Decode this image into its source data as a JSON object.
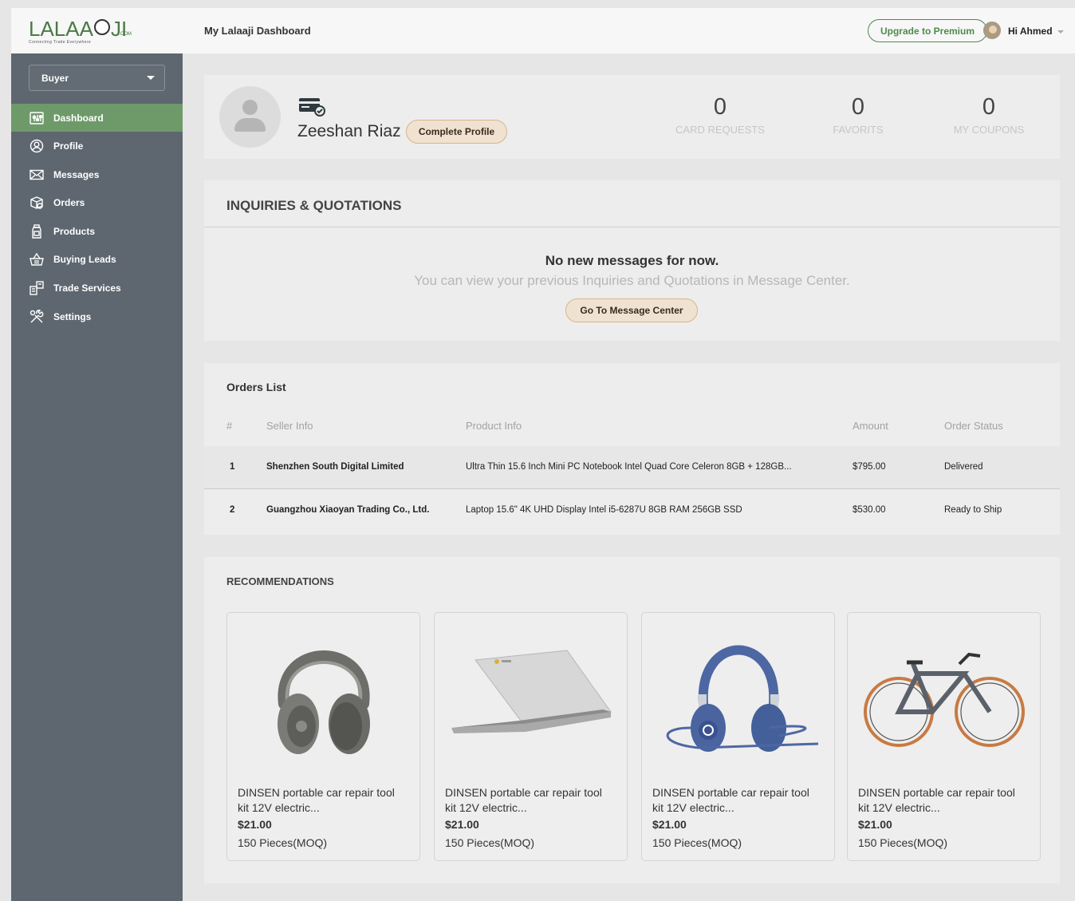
{
  "brand": {
    "logo_text": "LALAA",
    "logo_suffix": "JI",
    "logo_com": ".COM",
    "tagline": "Connecting Trade Everywhere"
  },
  "header": {
    "title": "My Lalaaji Dashboard",
    "upgrade_label": "Upgrade to Premium",
    "greeting": "Hi Ahmed"
  },
  "sidebar": {
    "role": "Buyer",
    "items": [
      {
        "label": "Dashboard",
        "icon": "dashboard-icon"
      },
      {
        "label": "Profile",
        "icon": "user-icon"
      },
      {
        "label": "Messages",
        "icon": "envelope-icon"
      },
      {
        "label": "Orders",
        "icon": "box-icon"
      },
      {
        "label": "Products",
        "icon": "bottle-icon"
      },
      {
        "label": "Buying Leads",
        "icon": "basket-icon"
      },
      {
        "label": "Trade Services",
        "icon": "handshake-icon"
      },
      {
        "label": "Settings",
        "icon": "tools-icon"
      }
    ]
  },
  "profile": {
    "name": "Zeeshan Riaz",
    "complete_label": "Complete Profile",
    "stats": [
      {
        "value": "0",
        "label": "CARD REQUESTS"
      },
      {
        "value": "0",
        "label": "FAVORITS"
      },
      {
        "value": "0",
        "label": "MY COUPONS"
      }
    ]
  },
  "inquiries": {
    "title": "INQUIRIES & QUOTATIONS",
    "empty_heading": "No new messages for now.",
    "empty_sub": "You can view your previous Inquiries and Quotations in Message Center.",
    "button_label": "Go To Message Center"
  },
  "orders": {
    "title": "Orders List",
    "columns": [
      "#",
      "Seller Info",
      "Product Info",
      "Amount",
      "Order Status"
    ],
    "rows": [
      {
        "num": "1",
        "seller": "Shenzhen South Digital Limited",
        "product": "Ultra Thin 15.6 Inch Mini PC Notebook Intel Quad Core Celeron 8GB + 128GB...",
        "amount": "$795.00",
        "status": "Delivered"
      },
      {
        "num": "2",
        "seller": "Guangzhou Xiaoyan Trading Co., Ltd.",
        "product": "Laptop 15.6\" 4K UHD Display Intel i5-6287U 8GB RAM 256GB SSD",
        "amount": "$530.00",
        "status": "Ready to Ship"
      }
    ]
  },
  "recommendations": {
    "title": "RECOMMENDATIONS",
    "products": [
      {
        "name": "DINSEN portable car repair tool kit 12V electric...",
        "price": "$21.00",
        "moq": "150 Pieces(MOQ)",
        "image": "headphones-gray"
      },
      {
        "name": "DINSEN portable car repair tool kit 12V electric...",
        "price": "$21.00",
        "moq": "150 Pieces(MOQ)",
        "image": "laptop-silver"
      },
      {
        "name": "DINSEN portable car repair tool kit 12V electric...",
        "price": "$21.00",
        "moq": "150 Pieces(MOQ)",
        "image": "headphones-blue"
      },
      {
        "name": "DINSEN portable car repair tool kit 12V electric...",
        "price": "$21.00",
        "moq": "150 Pieces(MOQ)",
        "image": "bicycle"
      }
    ]
  },
  "colors": {
    "sidebar": "#5e6770",
    "active": "#6e9a6a",
    "brand_green": "#4e8a4b",
    "accent_button": "#efe2d0"
  }
}
